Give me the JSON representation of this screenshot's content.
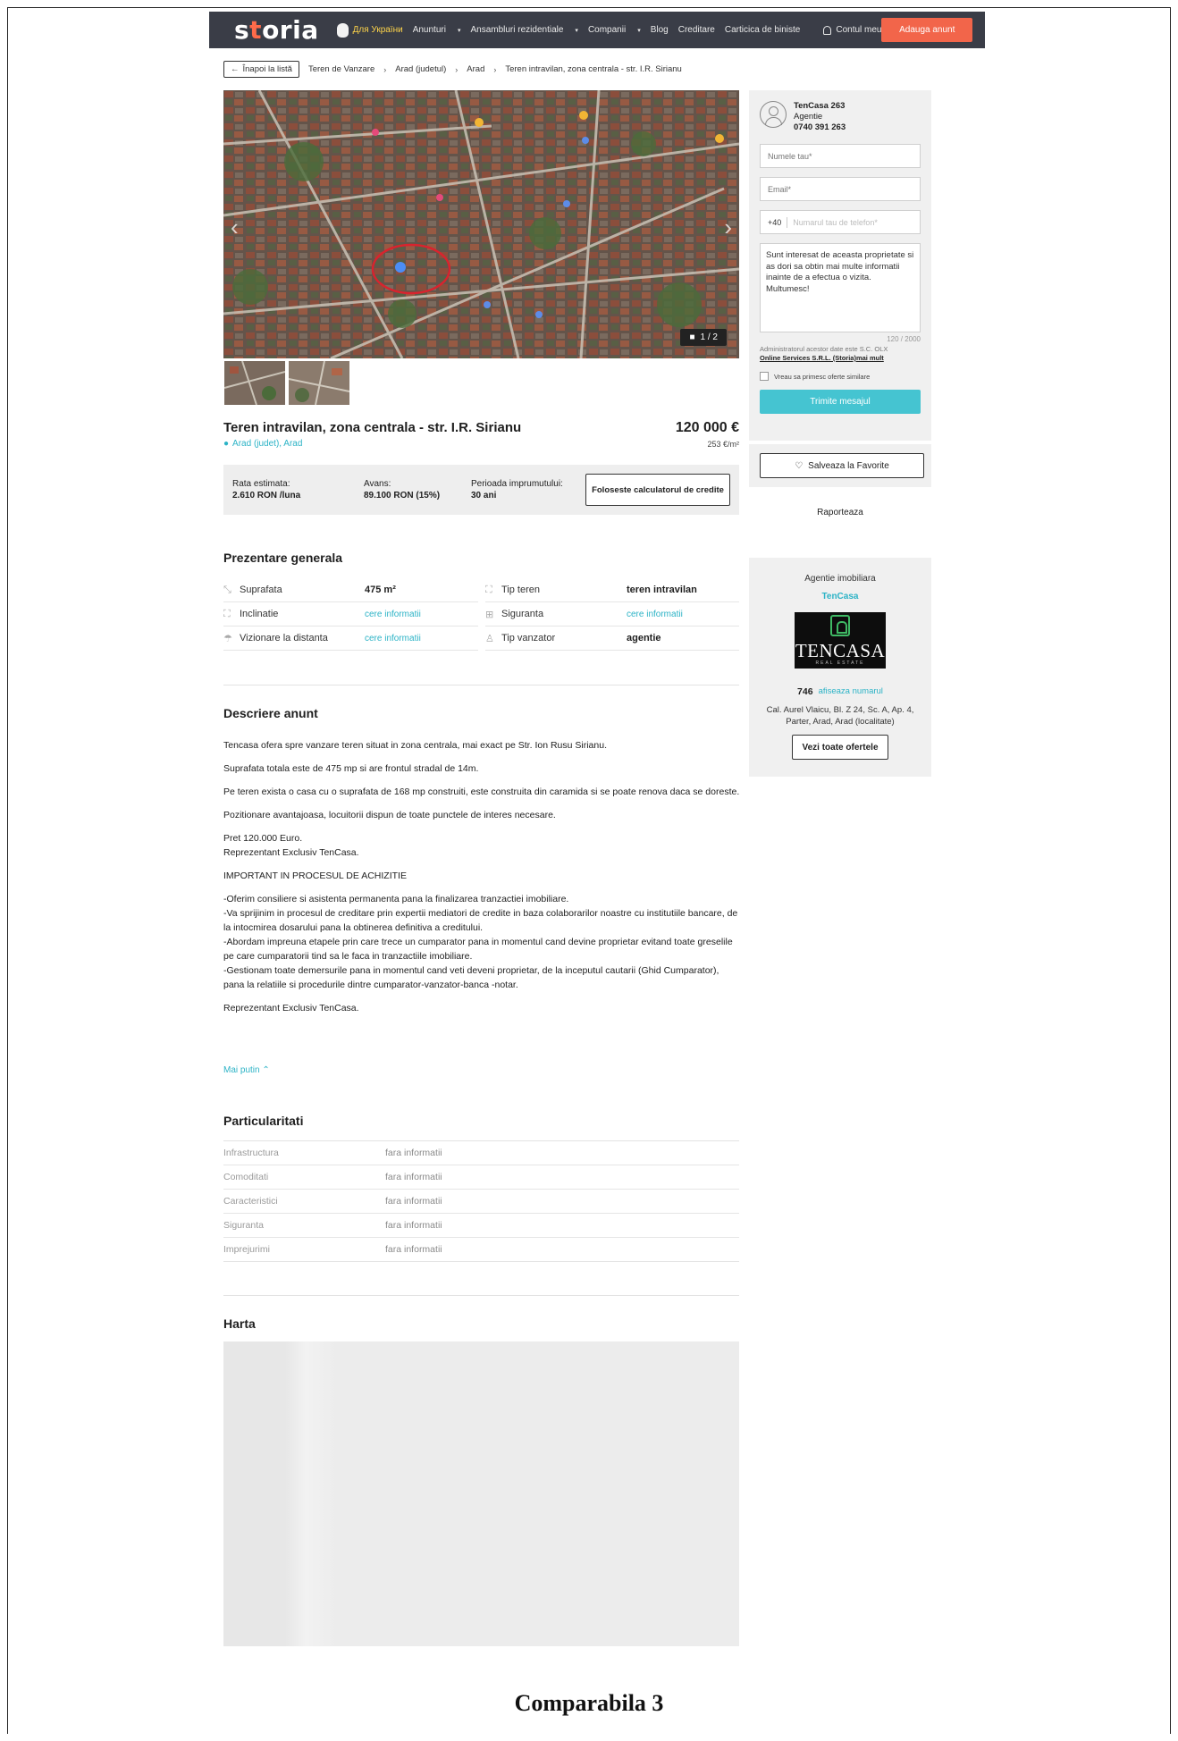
{
  "header": {
    "logo_prefix": "s",
    "logo_accent": "t",
    "logo_rest": "oria",
    "ua_label": "Для України",
    "nav": [
      "Anunturi",
      "Ansambluri rezidentiale",
      "Companii",
      "Blog",
      "Creditare",
      "Carticica de biniste"
    ],
    "nav_dropdown": [
      true,
      true,
      true,
      false,
      false,
      false
    ],
    "account": "Contul meu",
    "add_button": "Adauga anunt"
  },
  "breadcrumb": {
    "back": "Înapoi la listă",
    "items": [
      "Teren de Vanzare",
      "Arad (judetul)",
      "Arad",
      "Teren intravilan, zona centrala - str. I.R. Sirianu"
    ]
  },
  "gallery": {
    "counter": "1 / 2",
    "thumbnails": 2
  },
  "listing": {
    "title": "Teren intravilan, zona centrala - str. I.R. Sirianu",
    "location": "Arad (judet), Arad",
    "price": "120 000 €",
    "price_per_m2": "253 €/m²"
  },
  "credit": {
    "rate_label": "Rata estimata:",
    "rate_value": "2.610 RON /luna",
    "advance_label": "Avans:",
    "advance_value": "89.100 RON (15%)",
    "period_label": "Perioada imprumutului:",
    "period_value": "30 ani",
    "calc_button": "Foloseste calculatorul de credite"
  },
  "overview": {
    "heading": "Prezentare generala",
    "rows": [
      [
        {
          "icon": "area-icon",
          "label": "Suprafata",
          "value": "475 m²",
          "link": false
        },
        {
          "icon": "land-type-icon",
          "label": "Tip teren",
          "value": "teren intravilan",
          "link": false
        }
      ],
      [
        {
          "icon": "slope-icon",
          "label": "Inclinatie",
          "value": "cere informatii",
          "link": true
        },
        {
          "icon": "security-icon",
          "label": "Siguranta",
          "value": "cere informatii",
          "link": true
        }
      ],
      [
        {
          "icon": "remote-view-icon",
          "label": "Vizionare la distanta",
          "value": "cere informatii",
          "link": true
        },
        {
          "icon": "seller-icon",
          "label": "Tip vanzator",
          "value": "agentie",
          "link": false
        }
      ]
    ]
  },
  "description": {
    "heading": "Descriere anunt",
    "paragraphs": [
      "Tencasa ofera spre vanzare teren situat in zona centrala, mai exact pe Str. Ion Rusu Sirianu.",
      "Suprafata totala este de 475 mp si are frontul stradal de 14m.",
      "Pe teren exista o casa cu o suprafata de 168 mp construiti, este construita din caramida si se poate renova daca se doreste.",
      "Pozitionare avantajoasa, locuitorii dispun de toate punctele de interes necesare.",
      "Pret 120.000 Euro.\nReprezentant Exclusiv TenCasa.",
      "IMPORTANT IN PROCESUL DE ACHIZITIE",
      "-Oferim consiliere si asistenta permanenta pana la finalizarea tranzactiei imobiliare.\n-Va sprijinim in procesul de creditare prin expertii mediatori de credite in baza colaborarilor noastre cu institutiile bancare, de la intocmirea dosarului pana la obtinerea definitiva a creditului.\n-Abordam impreuna etapele prin care trece un cumparator pana in momentul cand devine proprietar evitand toate greselile pe care cumparatorii tind sa le faca in tranzactiile imobiliare.\n-Gestionam toate demersurile pana in momentul cand veti deveni proprietar, de la inceputul cautarii (Ghid Cumparator), pana la relatiile si procedurile dintre cumparator-vanzator-banca -notar.",
      "Reprezentant Exclusiv TenCasa."
    ],
    "less": "Mai putin"
  },
  "features": {
    "heading": "Particularitati",
    "rows": [
      {
        "label": "Infrastructura",
        "value": "fara informatii"
      },
      {
        "label": "Comoditati",
        "value": "fara informatii"
      },
      {
        "label": "Caracteristici",
        "value": "fara informatii"
      },
      {
        "label": "Siguranta",
        "value": "fara informatii"
      },
      {
        "label": "Imprejurimi",
        "value": "fara informatii"
      }
    ]
  },
  "map": {
    "heading": "Harta"
  },
  "contact": {
    "agent_name": "TenCasa 263",
    "agent_type": "Agentie",
    "agent_phone": "0740 391 263",
    "name_placeholder": "Numele tau*",
    "email_placeholder": "Email*",
    "country_code": "+40",
    "phone_placeholder": "Numarul tau de telefon*",
    "message": "Sunt interesat de aceasta proprietate si as dori sa obtin mai multe informatii inainte de a efectua o vizita. Multumesc!",
    "char_count": "120 / 2000",
    "admin_text": "Administratorul acestor date este S.C. OLX",
    "admin_link": "Online Services S.R.L. (Storia)mai mult",
    "similar_offers": "Vreau sa primesc oferte similare",
    "send": "Trimite mesajul",
    "favorite": "Salveaza la Favorite",
    "report": "Raporteaza"
  },
  "agency": {
    "label": "Agentie imobiliara",
    "name": "TenCasa",
    "logo_text": "TENCASA",
    "logo_sub": "REAL ESTATE",
    "offers_count": "746",
    "show_number": "afiseaza numarul",
    "address": "Cal. Aurel Vlaicu, Bl. Z 24, Sc. A, Ap. 4, Parter, Arad, Arad (localitate)",
    "all_offers": "Vezi toate ofertele"
  },
  "caption": "Comparabila 3",
  "colors": {
    "header_bg": "#3a3d47",
    "accent": "#f2654a",
    "link": "#2cb3c6",
    "send": "#45c4d1"
  }
}
